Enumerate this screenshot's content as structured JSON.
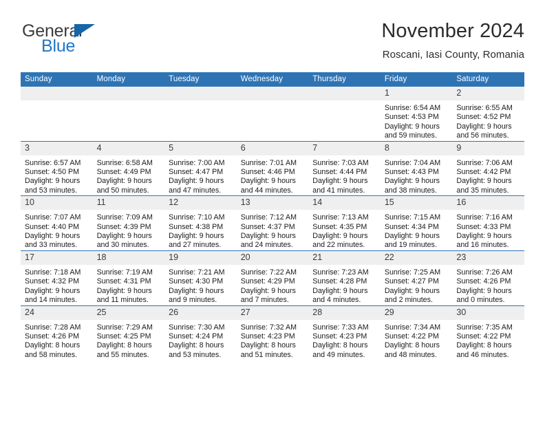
{
  "brand": {
    "name_part1": "General",
    "name_part2": "Blue",
    "triangle_icon": "triangle-icon",
    "color_dark": "#3b3b3b",
    "color_blue": "#2176c7"
  },
  "header": {
    "title": "November 2024",
    "subtitle": "Roscani, Iasi County, Romania"
  },
  "theme": {
    "header_blue": "#2e74b5",
    "daynum_band": "#efefef",
    "text": "#1a1a1a"
  },
  "weekday_headers": [
    "Sunday",
    "Monday",
    "Tuesday",
    "Wednesday",
    "Thursday",
    "Friday",
    "Saturday"
  ],
  "labels": {
    "sunrise_prefix": "Sunrise:",
    "sunset_prefix": "Sunset:",
    "daylight_prefix": "Daylight:"
  },
  "weeks": [
    [
      {
        "day": "",
        "l1": "",
        "l2": "",
        "l3": "",
        "l4": ""
      },
      {
        "day": "",
        "l1": "",
        "l2": "",
        "l3": "",
        "l4": ""
      },
      {
        "day": "",
        "l1": "",
        "l2": "",
        "l3": "",
        "l4": ""
      },
      {
        "day": "",
        "l1": "",
        "l2": "",
        "l3": "",
        "l4": ""
      },
      {
        "day": "",
        "l1": "",
        "l2": "",
        "l3": "",
        "l4": ""
      },
      {
        "day": "1",
        "l1": "Sunrise: 6:54 AM",
        "l2": "Sunset: 4:53 PM",
        "l3": "Daylight: 9 hours",
        "l4": "and 59 minutes."
      },
      {
        "day": "2",
        "l1": "Sunrise: 6:55 AM",
        "l2": "Sunset: 4:52 PM",
        "l3": "Daylight: 9 hours",
        "l4": "and 56 minutes."
      }
    ],
    [
      {
        "day": "3",
        "l1": "Sunrise: 6:57 AM",
        "l2": "Sunset: 4:50 PM",
        "l3": "Daylight: 9 hours",
        "l4": "and 53 minutes."
      },
      {
        "day": "4",
        "l1": "Sunrise: 6:58 AM",
        "l2": "Sunset: 4:49 PM",
        "l3": "Daylight: 9 hours",
        "l4": "and 50 minutes."
      },
      {
        "day": "5",
        "l1": "Sunrise: 7:00 AM",
        "l2": "Sunset: 4:47 PM",
        "l3": "Daylight: 9 hours",
        "l4": "and 47 minutes."
      },
      {
        "day": "6",
        "l1": "Sunrise: 7:01 AM",
        "l2": "Sunset: 4:46 PM",
        "l3": "Daylight: 9 hours",
        "l4": "and 44 minutes."
      },
      {
        "day": "7",
        "l1": "Sunrise: 7:03 AM",
        "l2": "Sunset: 4:44 PM",
        "l3": "Daylight: 9 hours",
        "l4": "and 41 minutes."
      },
      {
        "day": "8",
        "l1": "Sunrise: 7:04 AM",
        "l2": "Sunset: 4:43 PM",
        "l3": "Daylight: 9 hours",
        "l4": "and 38 minutes."
      },
      {
        "day": "9",
        "l1": "Sunrise: 7:06 AM",
        "l2": "Sunset: 4:42 PM",
        "l3": "Daylight: 9 hours",
        "l4": "and 35 minutes."
      }
    ],
    [
      {
        "day": "10",
        "l1": "Sunrise: 7:07 AM",
        "l2": "Sunset: 4:40 PM",
        "l3": "Daylight: 9 hours",
        "l4": "and 33 minutes."
      },
      {
        "day": "11",
        "l1": "Sunrise: 7:09 AM",
        "l2": "Sunset: 4:39 PM",
        "l3": "Daylight: 9 hours",
        "l4": "and 30 minutes."
      },
      {
        "day": "12",
        "l1": "Sunrise: 7:10 AM",
        "l2": "Sunset: 4:38 PM",
        "l3": "Daylight: 9 hours",
        "l4": "and 27 minutes."
      },
      {
        "day": "13",
        "l1": "Sunrise: 7:12 AM",
        "l2": "Sunset: 4:37 PM",
        "l3": "Daylight: 9 hours",
        "l4": "and 24 minutes."
      },
      {
        "day": "14",
        "l1": "Sunrise: 7:13 AM",
        "l2": "Sunset: 4:35 PM",
        "l3": "Daylight: 9 hours",
        "l4": "and 22 minutes."
      },
      {
        "day": "15",
        "l1": "Sunrise: 7:15 AM",
        "l2": "Sunset: 4:34 PM",
        "l3": "Daylight: 9 hours",
        "l4": "and 19 minutes."
      },
      {
        "day": "16",
        "l1": "Sunrise: 7:16 AM",
        "l2": "Sunset: 4:33 PM",
        "l3": "Daylight: 9 hours",
        "l4": "and 16 minutes."
      }
    ],
    [
      {
        "day": "17",
        "l1": "Sunrise: 7:18 AM",
        "l2": "Sunset: 4:32 PM",
        "l3": "Daylight: 9 hours",
        "l4": "and 14 minutes."
      },
      {
        "day": "18",
        "l1": "Sunrise: 7:19 AM",
        "l2": "Sunset: 4:31 PM",
        "l3": "Daylight: 9 hours",
        "l4": "and 11 minutes."
      },
      {
        "day": "19",
        "l1": "Sunrise: 7:21 AM",
        "l2": "Sunset: 4:30 PM",
        "l3": "Daylight: 9 hours",
        "l4": "and 9 minutes."
      },
      {
        "day": "20",
        "l1": "Sunrise: 7:22 AM",
        "l2": "Sunset: 4:29 PM",
        "l3": "Daylight: 9 hours",
        "l4": "and 7 minutes."
      },
      {
        "day": "21",
        "l1": "Sunrise: 7:23 AM",
        "l2": "Sunset: 4:28 PM",
        "l3": "Daylight: 9 hours",
        "l4": "and 4 minutes."
      },
      {
        "day": "22",
        "l1": "Sunrise: 7:25 AM",
        "l2": "Sunset: 4:27 PM",
        "l3": "Daylight: 9 hours",
        "l4": "and 2 minutes."
      },
      {
        "day": "23",
        "l1": "Sunrise: 7:26 AM",
        "l2": "Sunset: 4:26 PM",
        "l3": "Daylight: 9 hours",
        "l4": "and 0 minutes."
      }
    ],
    [
      {
        "day": "24",
        "l1": "Sunrise: 7:28 AM",
        "l2": "Sunset: 4:26 PM",
        "l3": "Daylight: 8 hours",
        "l4": "and 58 minutes."
      },
      {
        "day": "25",
        "l1": "Sunrise: 7:29 AM",
        "l2": "Sunset: 4:25 PM",
        "l3": "Daylight: 8 hours",
        "l4": "and 55 minutes."
      },
      {
        "day": "26",
        "l1": "Sunrise: 7:30 AM",
        "l2": "Sunset: 4:24 PM",
        "l3": "Daylight: 8 hours",
        "l4": "and 53 minutes."
      },
      {
        "day": "27",
        "l1": "Sunrise: 7:32 AM",
        "l2": "Sunset: 4:23 PM",
        "l3": "Daylight: 8 hours",
        "l4": "and 51 minutes."
      },
      {
        "day": "28",
        "l1": "Sunrise: 7:33 AM",
        "l2": "Sunset: 4:23 PM",
        "l3": "Daylight: 8 hours",
        "l4": "and 49 minutes."
      },
      {
        "day": "29",
        "l1": "Sunrise: 7:34 AM",
        "l2": "Sunset: 4:22 PM",
        "l3": "Daylight: 8 hours",
        "l4": "and 48 minutes."
      },
      {
        "day": "30",
        "l1": "Sunrise: 7:35 AM",
        "l2": "Sunset: 4:22 PM",
        "l3": "Daylight: 8 hours",
        "l4": "and 46 minutes."
      }
    ]
  ]
}
